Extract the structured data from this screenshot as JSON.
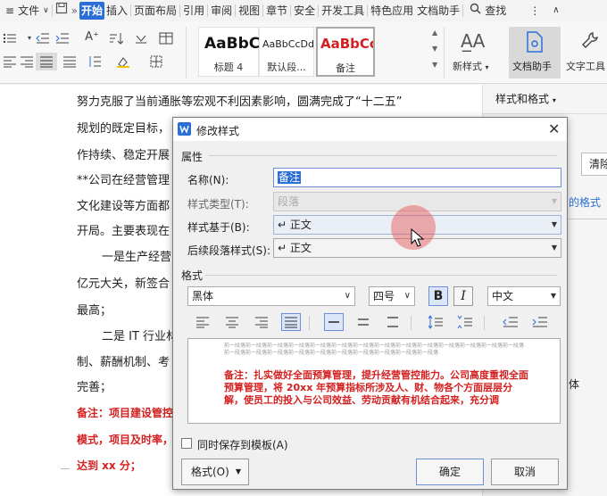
{
  "menubar": {
    "file_label": "文件",
    "tabs": [
      "开始",
      "插入",
      "页面布局",
      "引用",
      "审阅",
      "视图",
      "章节",
      "安全",
      "开发工具",
      "特色应用",
      "文档助手"
    ],
    "active_tab": "开始",
    "search_label": "查找"
  },
  "ribbon": {
    "styles": [
      {
        "preview": "AaBbC",
        "label": "标题 4"
      },
      {
        "preview": "AaBbCcDd",
        "label": "默认段..."
      },
      {
        "preview": "AaBbCcI",
        "label": "备注"
      }
    ],
    "new_style_label": "新样式",
    "doc_helper_label": "文档助手",
    "text_tools_label": "文字工具"
  },
  "document": {
    "lines": [
      "努力克服了当前通胀等宏观不利因素影响，圆满完成了“十二五”",
      "规划的既定目标，",
      "作持续、稳定开展",
      "**公司在经营管理",
      "文化建设等方面都",
      "开局。主要表现在",
      "一是生产经营",
      "亿元大关，新签合",
      "最高；",
      "二是 IT 行业林",
      "制、薪酬机制、考",
      "完善；"
    ],
    "red_lines": [
      "备注：项目建设管控",
      "模式，项目及时率，",
      "达到 xx 分；"
    ]
  },
  "right_pane": {
    "title": "样式和格式",
    "clear_label": "清除",
    "partial_link": "的格式",
    "partial_text": "体"
  },
  "dialog": {
    "title": "修改样式",
    "section_properties": "属性",
    "name_label": "名称(N):",
    "name_value": "备注",
    "type_label": "样式类型(T):",
    "type_value": "段落",
    "based_label": "样式基于(B):",
    "based_value": "↵ 正文",
    "next_label": "后续段落样式(S):",
    "next_value": "↵ 正文",
    "section_format": "格式",
    "font_value": "黑体",
    "size_value": "四号",
    "bold_label": "B",
    "italic_label": "I",
    "lang_value": "中文",
    "preview_prev_text": "前一段落前一段落前一段落前一段落前一段落前一段落前一段落前一段落前一段落前一段落前一段落前一段落前一段落前一段落前一段落前一段落前一段落前一段落前一段落前一段落前一段落前一段落前一段落前一段落",
    "preview_sample": "备注：扎实做好全面预算管理，提升经营管控能力。公司高度重视全面预算管理，将 20xx 年预算指标所涉及人、财、物各个方面层层分解，使员工的投入与公司效益、劳动贡献有机结合起来，充分调",
    "save_template_label": "同时保存到模板(A)",
    "save_template_checked": false,
    "format_button": "格式(O)",
    "ok_button": "确定",
    "cancel_button": "取消"
  }
}
